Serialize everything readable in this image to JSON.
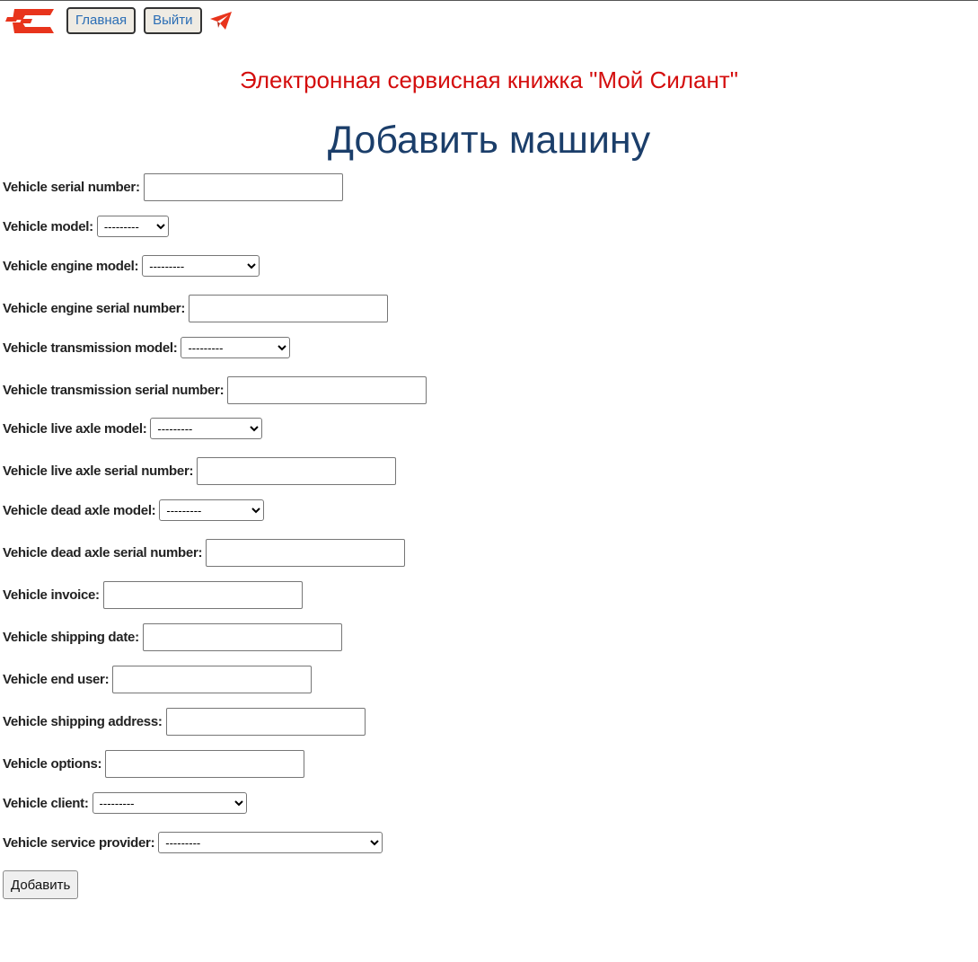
{
  "header": {
    "logo_icon": "silant-logo-icon",
    "home_label": "Главная",
    "logout_label": "Выйти",
    "telegram_icon": "telegram-icon"
  },
  "subtitle": "Электронная сервисная книжка \"Мой Силант\"",
  "title": "Добавить машину",
  "form": {
    "serial_number": {
      "label": "Vehicle serial number:",
      "value": ""
    },
    "model": {
      "label": "Vehicle model:",
      "value": "---------"
    },
    "engine_model": {
      "label": "Vehicle engine model:",
      "value": "---------"
    },
    "engine_serial": {
      "label": "Vehicle engine serial number:",
      "value": ""
    },
    "transmission_model": {
      "label": "Vehicle transmission model:",
      "value": "---------"
    },
    "transmission_serial": {
      "label": "Vehicle transmission serial number:",
      "value": ""
    },
    "live_axle_model": {
      "label": "Vehicle live axle model:",
      "value": "---------"
    },
    "live_axle_serial": {
      "label": "Vehicle live axle serial number:",
      "value": ""
    },
    "dead_axle_model": {
      "label": "Vehicle dead axle model:",
      "value": "---------"
    },
    "dead_axle_serial": {
      "label": "Vehicle dead axle serial number:",
      "value": ""
    },
    "invoice": {
      "label": "Vehicle invoice:",
      "value": ""
    },
    "shipping_date": {
      "label": "Vehicle shipping date:",
      "value": ""
    },
    "end_user": {
      "label": "Vehicle end user:",
      "value": ""
    },
    "shipping_address": {
      "label": "Vehicle shipping address:",
      "value": ""
    },
    "options": {
      "label": "Vehicle options:",
      "value": ""
    },
    "client": {
      "label": "Vehicle client:",
      "value": "---------"
    },
    "service_provider": {
      "label": "Vehicle service provider:",
      "value": "---------"
    },
    "submit_label": "Добавить"
  },
  "colors": {
    "subtitle": "#d40d0d",
    "title": "#1b3e6a",
    "nav_link": "#2a6db5",
    "brand": "#e8341c"
  }
}
